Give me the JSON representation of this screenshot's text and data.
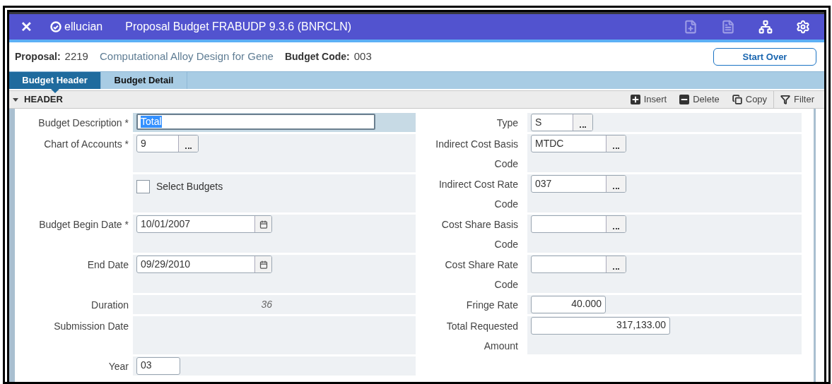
{
  "app_bar": {
    "close": "✕",
    "logo": "ellucian",
    "title": "Proposal Budget FRABUDP 9.3.6 (BNRCLN)",
    "icons": [
      {
        "kind": "add-document",
        "disabled": true
      },
      {
        "kind": "document",
        "disabled": true
      },
      {
        "kind": "hierarchy",
        "disabled": false
      },
      {
        "kind": "settings",
        "disabled": false
      }
    ]
  },
  "context": {
    "items": [
      {
        "label": "Proposal:",
        "value": "2219"
      },
      {
        "value": "Computational Alloy Design for Gene"
      },
      {
        "label": "Budget Code:",
        "value": "003"
      }
    ],
    "start_over": "Start Over"
  },
  "tabs": [
    {
      "label": "Budget Header",
      "selected": true
    },
    {
      "label": "Budget Detail",
      "selected": false
    }
  ],
  "section": {
    "title": "HEADER",
    "expanded": true,
    "actions": [
      {
        "kind": "insert",
        "label": "Insert"
      },
      {
        "kind": "delete",
        "label": "Delete"
      },
      {
        "kind": "copy",
        "label": "Copy"
      },
      {
        "kind": "filter",
        "label": "Filter"
      }
    ]
  },
  "left_fields": [
    {
      "label": "Budget Description *",
      "kind": "text",
      "value": "Total",
      "value_selected": true,
      "focused": true
    },
    {
      "label": "Chart of Accounts *",
      "kind": "code",
      "value": "9",
      "focused": false
    },
    {
      "kind": "checkbox",
      "checkbox_label": "Select Budgets",
      "checked": false,
      "focused": false
    },
    {
      "label": "Budget Begin Date *",
      "kind": "date",
      "value": "10/01/2007",
      "focused": false
    },
    {
      "label": "End Date",
      "kind": "date",
      "value": "09/29/2010",
      "focused": false
    },
    {
      "label": "Duration",
      "kind": "display",
      "value": "36",
      "focused": false
    },
    {
      "label": "Submission Date",
      "kind": "empty",
      "focused": false
    },
    {
      "label": "Year",
      "kind": "short",
      "value": "03",
      "focused": false
    }
  ],
  "right_fields": [
    {
      "label": "Type",
      "kind": "code",
      "value": "S"
    },
    {
      "label": "Indirect Cost Basis Code",
      "kind": "lookup",
      "value": "MTDC"
    },
    {
      "label": "Indirect Cost Rate Code",
      "kind": "lookup",
      "value": "037"
    },
    {
      "label": "Cost Share Basis Code",
      "kind": "lookup"
    },
    {
      "label": "Cost Share Rate Code",
      "kind": "lookup"
    },
    {
      "label": "Fringe Rate",
      "kind": "rate",
      "value": "40.000"
    },
    {
      "label": "Total Requested Amount",
      "kind": "amount",
      "value": "317,133.00"
    }
  ]
}
